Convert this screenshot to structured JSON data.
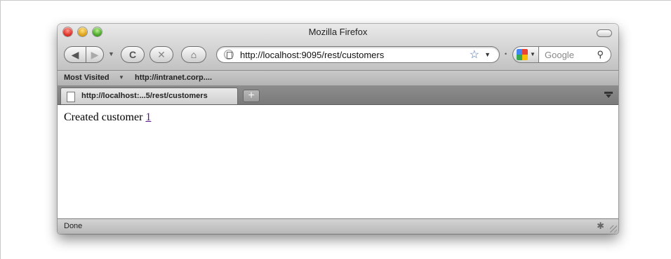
{
  "window": {
    "title": "Mozilla Firefox"
  },
  "toolbar": {
    "address": "http://localhost:9095/rest/customers",
    "search_placeholder": "Google",
    "icons": {
      "back": "back-arrow-icon",
      "forward": "forward-arrow-icon",
      "reload": "reload-icon",
      "stop": "stop-icon",
      "home": "home-icon",
      "bookmark_star": "star-icon",
      "search": "magnifier-icon"
    }
  },
  "bookmarks": {
    "items": [
      {
        "label": "Most Visited"
      },
      {
        "label": "http://intranet.corp...."
      }
    ]
  },
  "tabs": [
    {
      "label": "http://localhost:...5/rest/customers"
    }
  ],
  "content": {
    "message": "Created customer ",
    "link_text": "1",
    "link_color": "#551a8b"
  },
  "status": {
    "text": "Done"
  }
}
